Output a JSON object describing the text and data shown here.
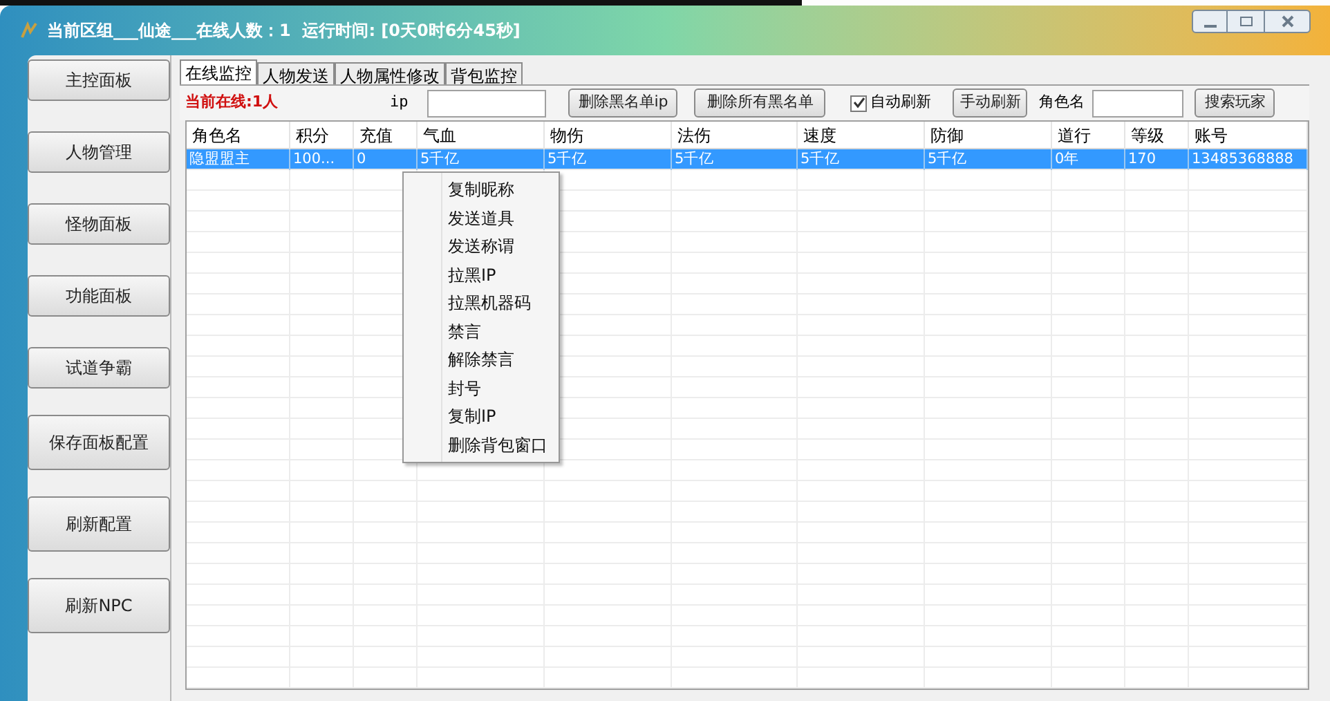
{
  "window": {
    "title": "当前区组___仙途___在线人数：1  运行时间: [0天0时6分45秒]"
  },
  "sidebar": {
    "items": [
      {
        "label": "主控面板"
      },
      {
        "label": "人物管理"
      },
      {
        "label": "怪物面板"
      },
      {
        "label": "功能面板"
      },
      {
        "label": "试道争霸"
      },
      {
        "label": "保存面板配置",
        "kind": "tall"
      },
      {
        "label": "刷新配置",
        "kind": "tall"
      },
      {
        "label": "刷新NPC",
        "kind": "tall"
      }
    ]
  },
  "tabs": [
    {
      "label": "在线监控",
      "selected": true
    },
    {
      "label": "人物发送",
      "selected": false
    },
    {
      "label": "人物属性修改",
      "selected": false
    },
    {
      "label": "背包监控",
      "selected": false
    }
  ],
  "toolbar": {
    "online_count": "当前在线:1人",
    "ip_label": "ip",
    "delete_blacklist_ip": "删除黑名单ip",
    "delete_all_blacklist": "删除所有黑名单",
    "auto_refresh": {
      "label": "自动刷新",
      "checked": true
    },
    "manual_refresh": "手动刷新",
    "role_name_label": "角色名",
    "search_player": "搜索玩家"
  },
  "table": {
    "columns": [
      "角色名",
      "积分",
      "充值",
      "气血",
      "物伤",
      "法伤",
      "速度",
      "防御",
      "道行",
      "等级",
      "账号"
    ],
    "rows": [
      {
        "selected": true,
        "cells": [
          "隐盟盟主",
          "100...",
          "0",
          "5千亿",
          "5千亿",
          "5千亿",
          "5千亿",
          "5千亿",
          "0年",
          "170",
          "13485368888"
        ]
      }
    ]
  },
  "context_menu": {
    "items": [
      "复制昵称",
      "发送道具",
      "发送称谓",
      "拉黑IP",
      "拉黑机器码",
      "禁言",
      "解除禁言",
      "封号",
      "复制IP",
      "删除背包窗口"
    ]
  }
}
